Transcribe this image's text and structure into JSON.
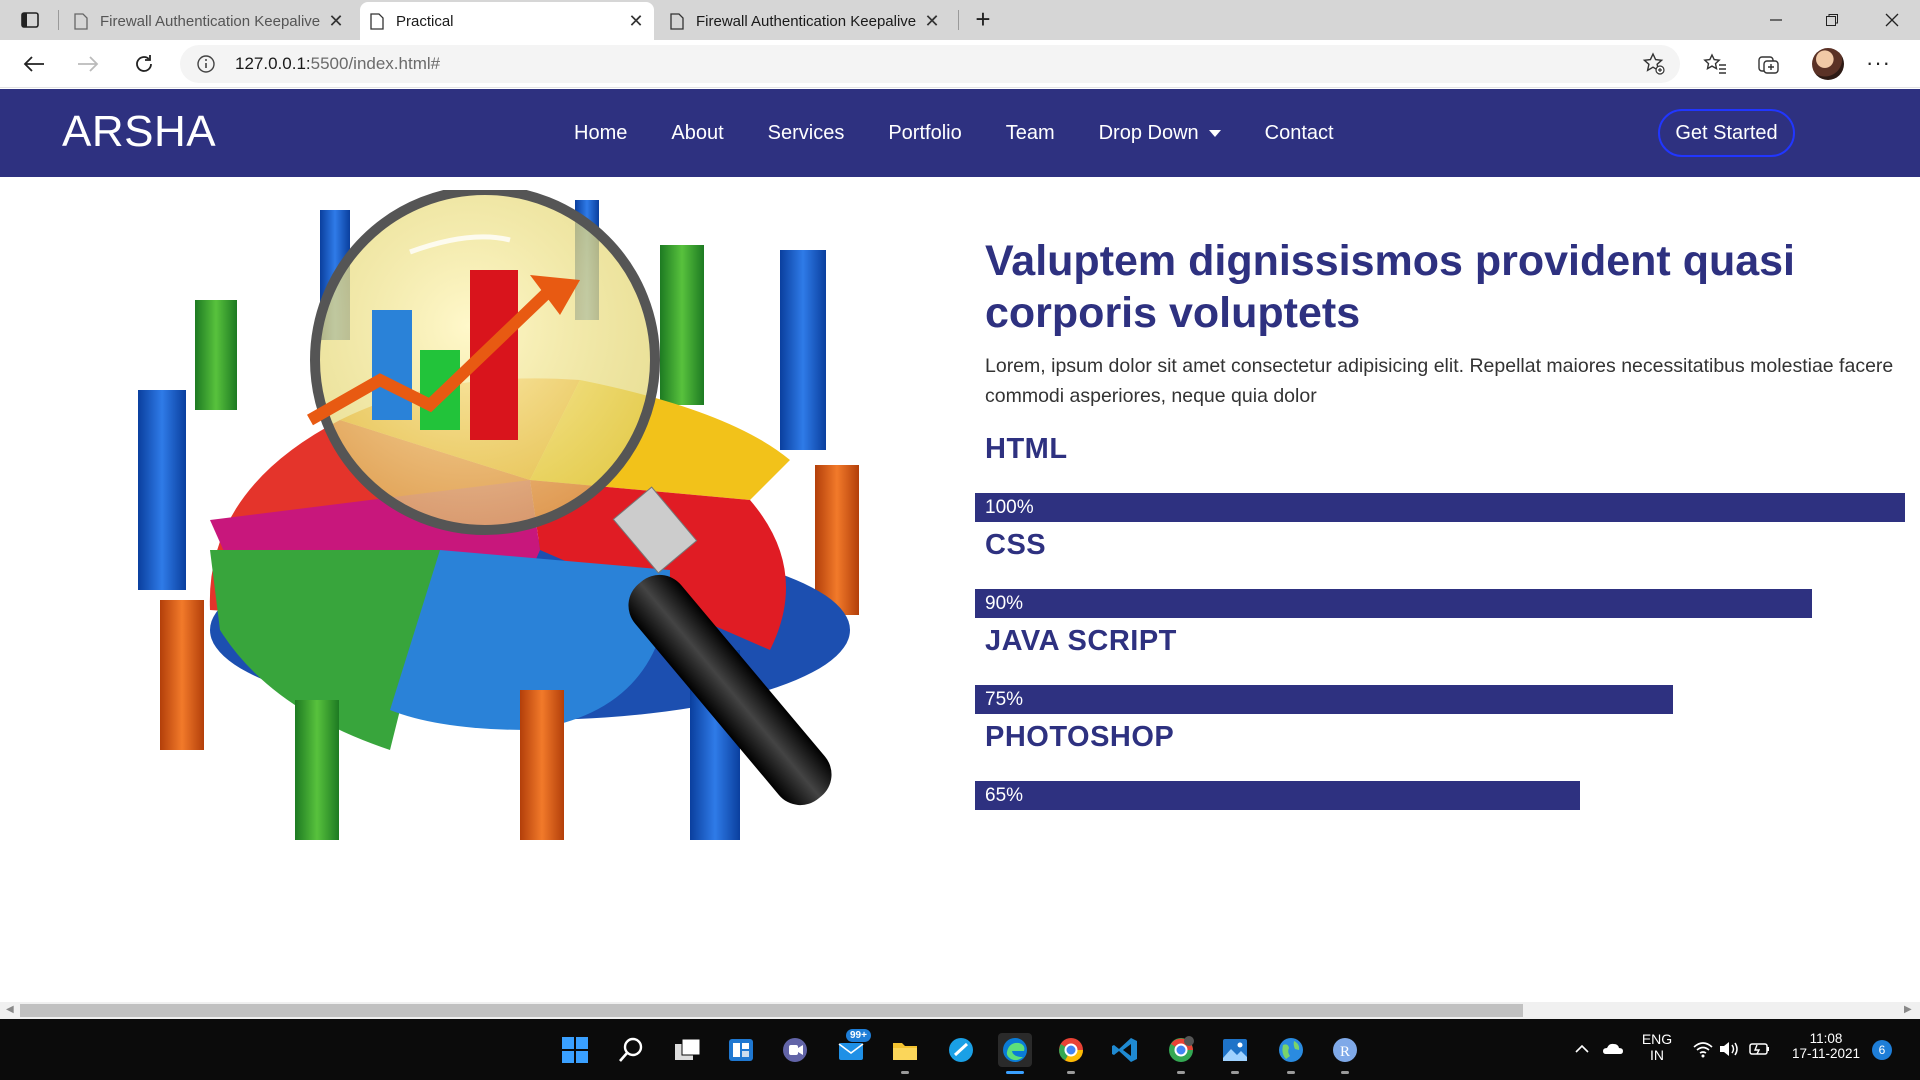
{
  "browser": {
    "tabs": [
      {
        "title": "Firewall Authentication Keepalive",
        "active": false
      },
      {
        "title": "Practical",
        "active": true
      },
      {
        "title": "Firewall Authentication Keepalive",
        "active": false
      }
    ],
    "tab_close_glyph": "✕",
    "new_tab_glyph": "+",
    "url_host": "127.0.0.1:",
    "url_rest": "5500/index.html#"
  },
  "site": {
    "logo": "ARSHA",
    "nav": [
      "Home",
      "About",
      "Services",
      "Portfolio",
      "Team",
      "Drop Down",
      "Contact"
    ],
    "cta": "Get Started",
    "headline": "Valuptem dignissismos provident quasi corporis voluptets",
    "lead_line1": "Lorem, ipsum dolor sit amet consectetur adipisicing elit. Repellat maiores necessitatibus molestiae facere",
    "lead_line2": "commodi asperiores, neque quia dolor",
    "skills": [
      {
        "name": "HTML",
        "percent_label": "100%",
        "level": 1.0
      },
      {
        "name": "CSS",
        "percent_label": "90%",
        "level": 0.9
      },
      {
        "name": "JAVA SCRIPT",
        "percent_label": "75%",
        "level": 0.75
      },
      {
        "name": "PHOTOSHOP",
        "percent_label": "65%",
        "level": 0.65
      }
    ],
    "accent": "#2e3180"
  },
  "taskbar": {
    "mail_badge": "99+",
    "lang": "ENG",
    "region": "IN",
    "time": "11:08",
    "date": "17-11-2021",
    "notifications": "6"
  }
}
